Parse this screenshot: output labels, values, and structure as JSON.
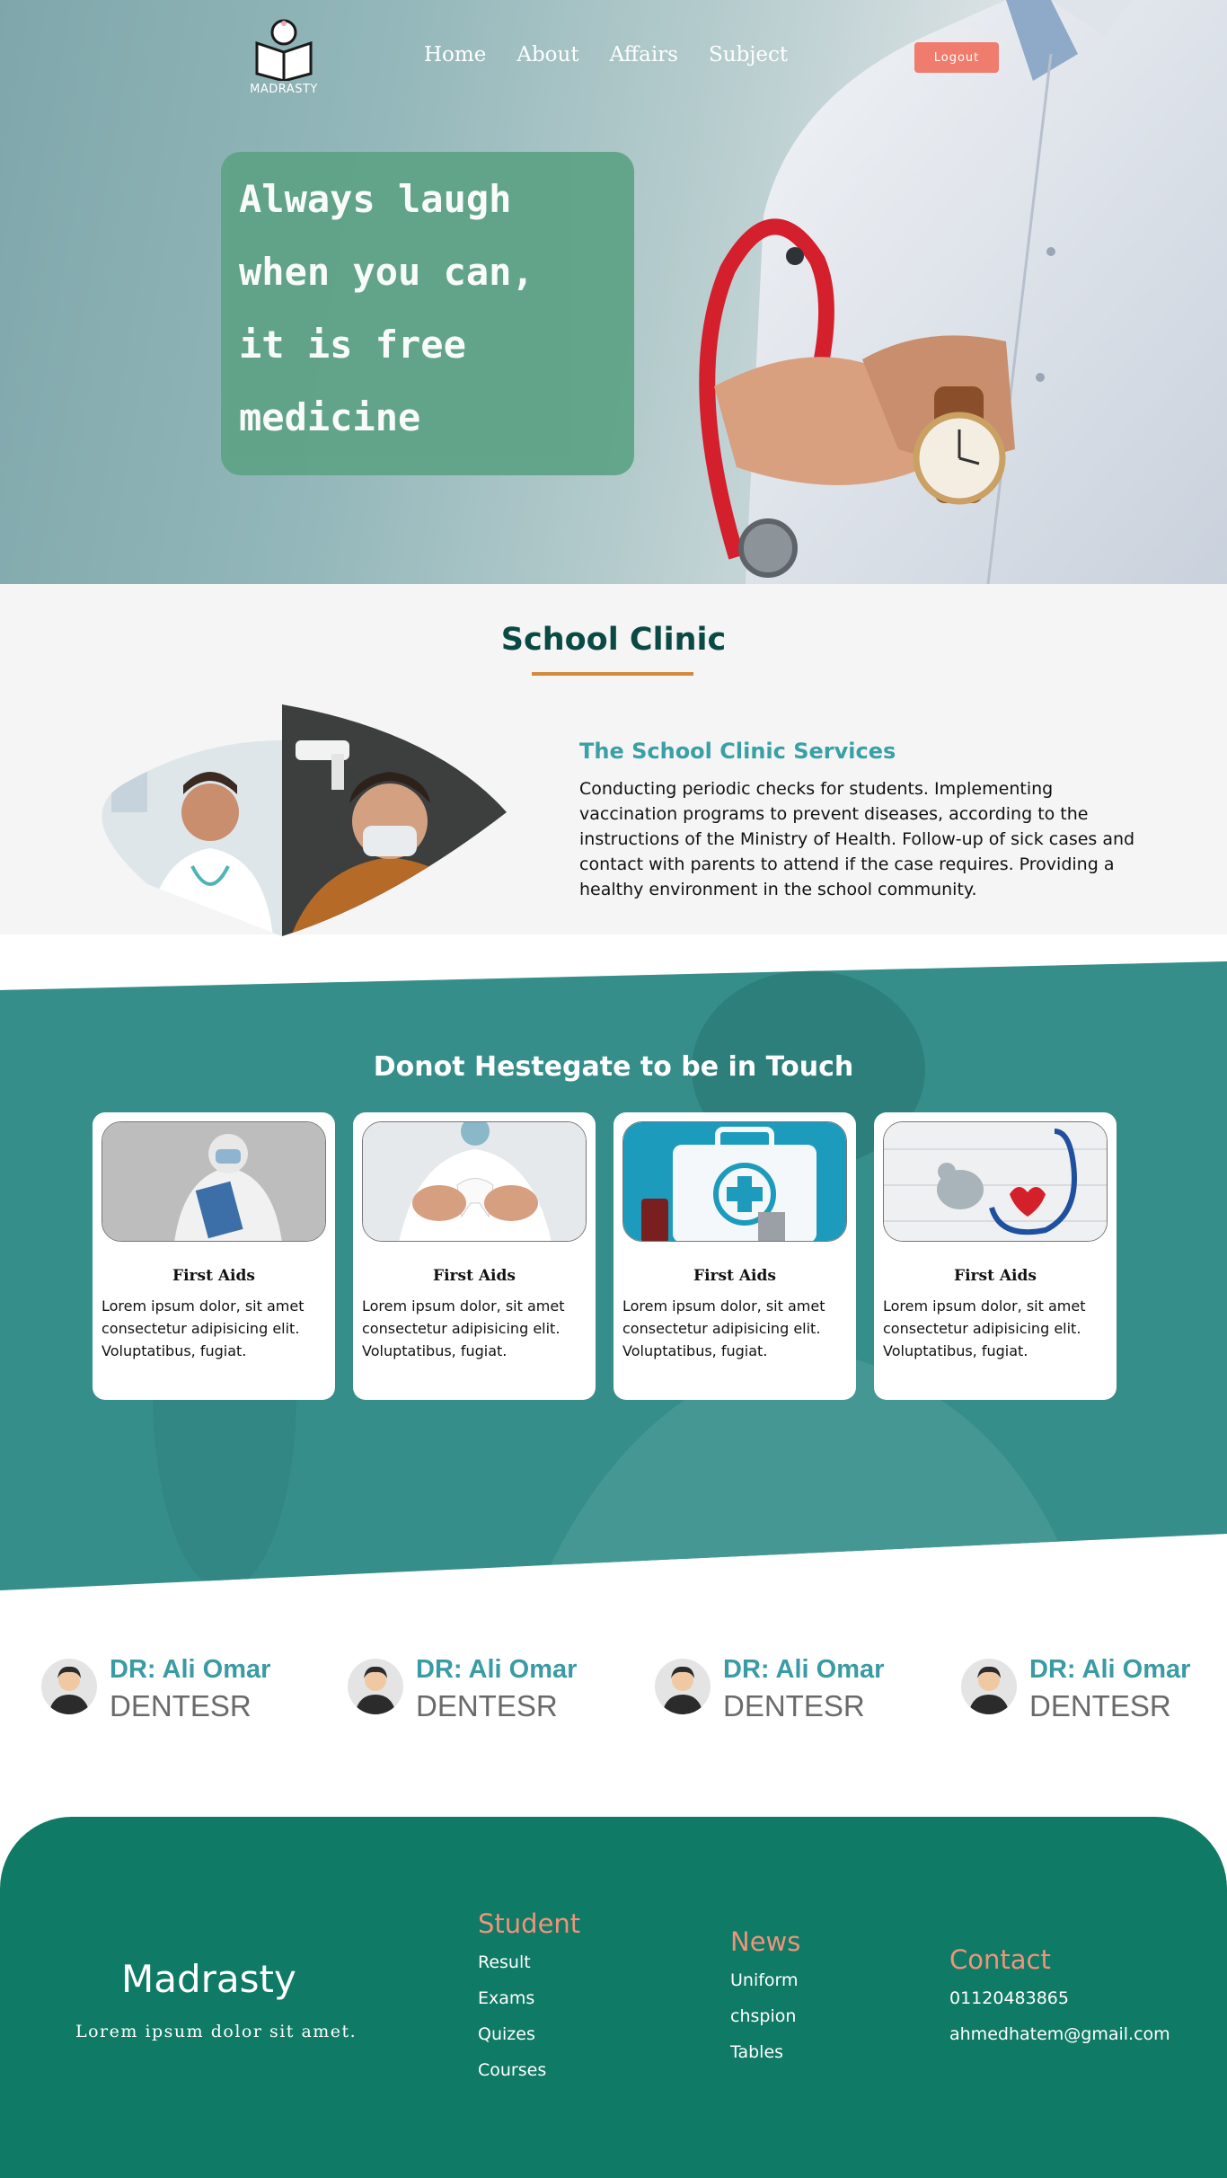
{
  "nav": {
    "logo_text": "MADRASTY",
    "links": [
      "Home",
      "About",
      "Affairs",
      "Subject"
    ],
    "logout_label": "Logout"
  },
  "hero": {
    "quote_lines": [
      "Always laugh",
      "when you can,",
      "it is free",
      "medicine"
    ]
  },
  "clinic": {
    "title": "School Clinic",
    "services_title": "The School Clinic Services",
    "services_text": "Conducting periodic checks for students. Implementing vaccination programs to prevent diseases, according to the instructions of the Ministry of Health. Follow-up of sick cases and contact with parents to attend if the case requires. Providing a healthy environment in the school community."
  },
  "touch": {
    "title": "Donot Hestegate to be in Touch",
    "cards": [
      {
        "title": "First Aids",
        "text": "Lorem ipsum dolor, sit amet consectetur adipisicing elit. Voluptatibus, fugiat.",
        "image": "doctor-ppe-image"
      },
      {
        "title": "First Aids",
        "text": "Lorem ipsum dolor, sit amet consectetur adipisicing elit. Voluptatibus, fugiat.",
        "image": "dentist-tooth-image"
      },
      {
        "title": "First Aids",
        "text": "Lorem ipsum dolor, sit amet consectetur adipisicing elit. Voluptatibus, fugiat.",
        "image": "first-aid-kit-image"
      },
      {
        "title": "First Aids",
        "text": "Lorem ipsum dolor, sit amet consectetur adipisicing elit. Voluptatibus, fugiat.",
        "image": "stethoscope-heart-image"
      }
    ]
  },
  "doctors": [
    {
      "name": "DR: Ali Omar",
      "role": "DENTESR"
    },
    {
      "name": "DR: Ali Omar",
      "role": "DENTESR"
    },
    {
      "name": "DR: Ali Omar",
      "role": "DENTESR"
    },
    {
      "name": "DR: Ali Omar",
      "role": "DENTESR"
    }
  ],
  "footer": {
    "brand": "Madrasty",
    "tagline": "Lorem ipsum dolor sit amet.",
    "student": {
      "title": "Student",
      "links": [
        "Result",
        "Exams",
        "Quizes",
        "Courses"
      ]
    },
    "news": {
      "title": "News",
      "links": [
        "Uniform",
        "chspion",
        "Tables"
      ]
    },
    "contact": {
      "title": "Contact",
      "phone": "01120483865",
      "email": "ahmedhatem@gmail.com"
    }
  },
  "colors": {
    "accent_teal": "#3aa0a5",
    "footer_green": "#0f7a65",
    "logout_red": "#ef7c6c",
    "quote_green": "#5fa387",
    "underline_orange": "#d38b3a"
  }
}
